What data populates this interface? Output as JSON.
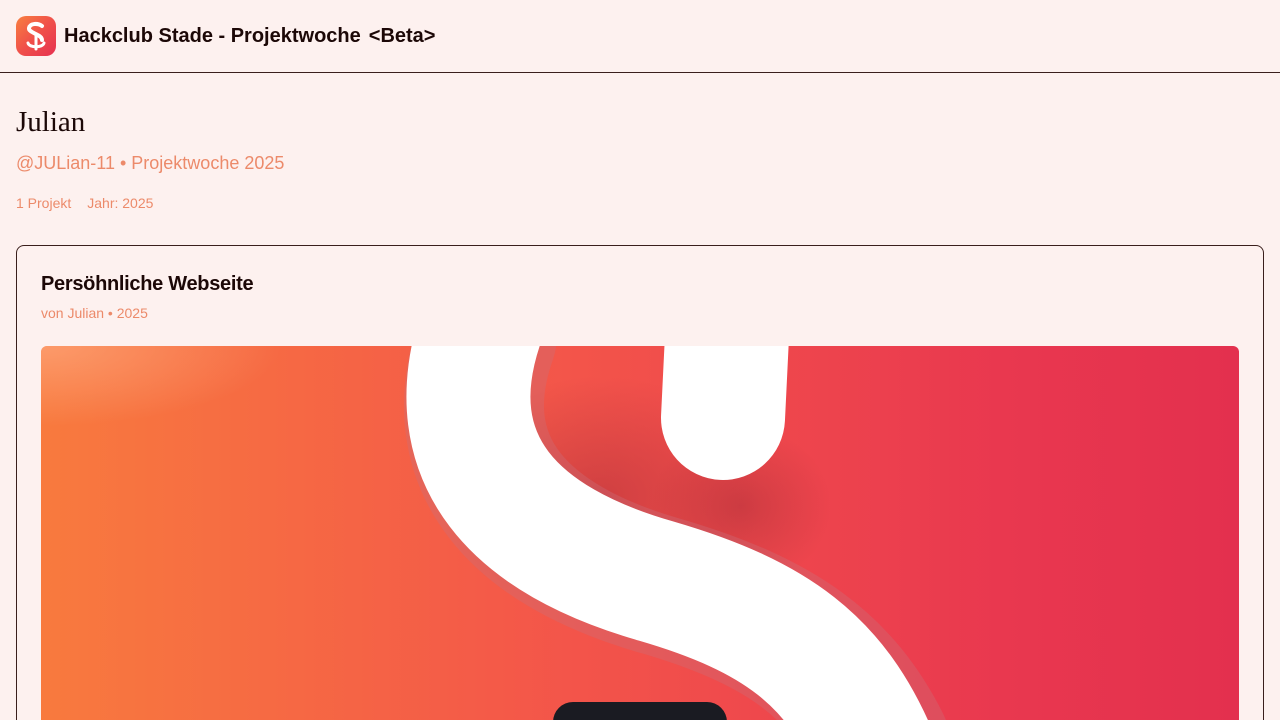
{
  "header": {
    "logo_icon": "hackclub-s-anchor-logo-icon",
    "title": "Hackclub Stade - Projektwoche",
    "badge": "<Beta>"
  },
  "profile": {
    "name": "Julian",
    "subtitle": "@JULian-11 • Projektwoche 2025",
    "project_count": "1 Projekt",
    "year": "Jahr: 2025"
  },
  "project": {
    "title": "Persöhnliche Webseite",
    "byline": "von Julian • 2025",
    "preview_icon": "s-logo-preview-image"
  },
  "colors": {
    "background": "#fdf1ef",
    "accent": "#ec8a6a",
    "gradient_start": "#f87a3e",
    "gradient_end": "#e3304e"
  }
}
